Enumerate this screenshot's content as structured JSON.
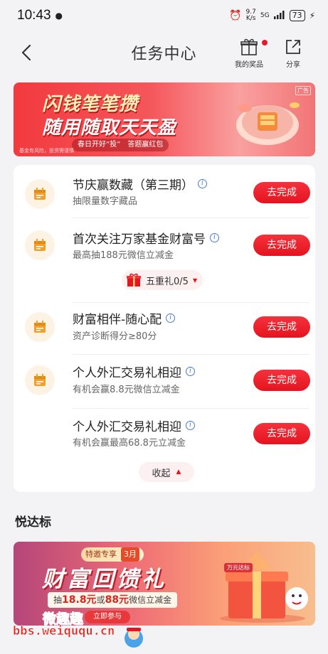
{
  "status_bar": {
    "time": "10:43",
    "speed_value": "9.7",
    "speed_unit": "K/s",
    "network": "5G",
    "battery": "73"
  },
  "header": {
    "title": "任务中心",
    "prizes_label": "我的奖品",
    "share_label": "分享"
  },
  "top_banner": {
    "line1": "闪钱笔笔攒",
    "line2": "随用随取天天盈",
    "pill_left": "春日开好“投”",
    "pill_right": "答题赢红包",
    "ad_label": "广告",
    "disclaimer": "基金有风险，投资需谨慎"
  },
  "tasks": [
    {
      "title": "节庆赢数藏（第三期）",
      "subtitle": "抽限量数字藏品",
      "button": "去完成"
    },
    {
      "title": "首次关注万家基金财富号",
      "subtitle": "最高抽188元微信立减金",
      "button": "去完成"
    },
    {
      "title": "财富相伴-随心配",
      "subtitle": "资产诊断得分≥80分",
      "button": "去完成"
    },
    {
      "title": "个人外汇交易礼相迎",
      "subtitle": "有机会赢8.8元微信立减金",
      "button": "去完成"
    },
    {
      "title": "个人外汇交易礼相迎",
      "subtitle": "有机会赢最高68.8元立减金",
      "button": "去完成"
    }
  ],
  "gift_pill": {
    "label": "五重礼0/5"
  },
  "collapse_label": "收起",
  "section": {
    "title": "悦达标"
  },
  "bottom_banner": {
    "tag": "特邀专享",
    "month": "3月",
    "title": "财富回馈礼",
    "sub_prefix": "抽",
    "amount1": "18.8元",
    "sub_mid": "或",
    "amount2": "88元",
    "sub_suffix": "微信立减金",
    "join": "立即参与",
    "box_label": "万元达标"
  },
  "watermark": {
    "top": "微趣趣",
    "bottom": "bbs.weiququ.cn"
  },
  "colors": {
    "accent_red": "#e5141f",
    "task_icon_bg": "#fdf3e4",
    "task_icon_fg": "#f1a02d"
  }
}
